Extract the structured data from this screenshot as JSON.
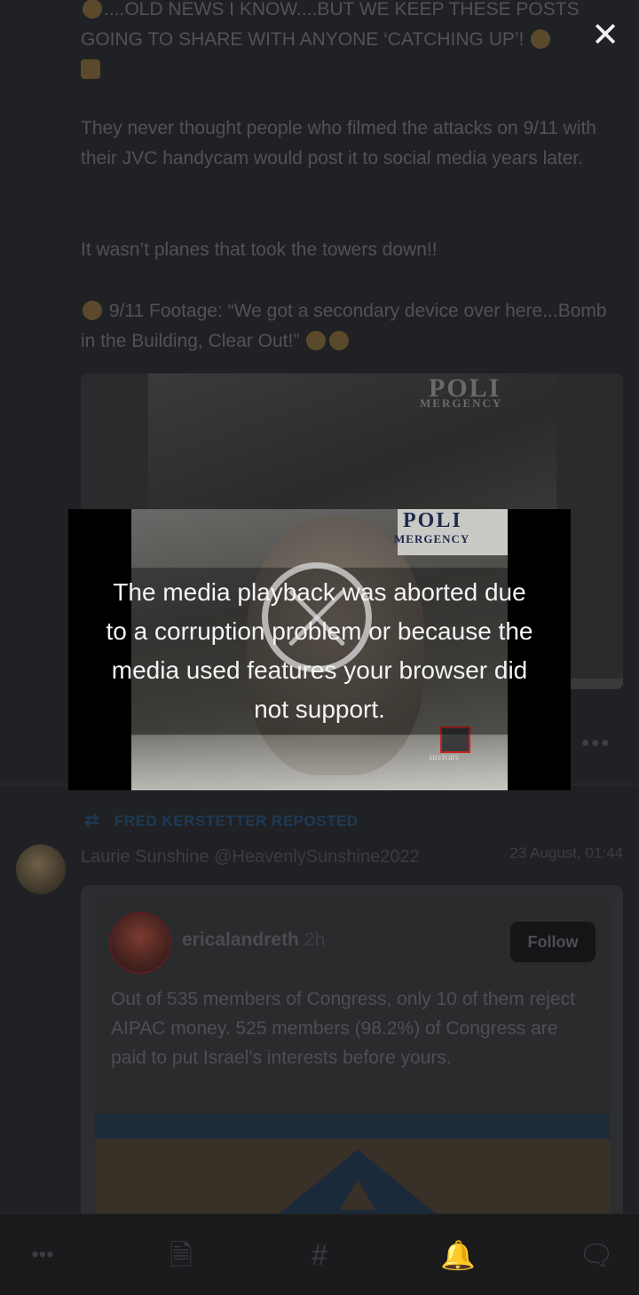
{
  "post": {
    "line1_text": "....OLD NEWS I KNOW....BUT WE KEEP THESE POSTS",
    "line2_text": "GOING TO SHARE WITH ANYONE ‘CATCHING UP’!",
    "paragraph1": "They never thought people who filmed the attacks on 9/11 with their JVC handycam would post it to social media years later.",
    "paragraph2": "It wasn’t planes that took the towers down!!",
    "paragraph3": "9/11 Footage: “We got a secondary device over here...Bomb in the Building, Clear Out!”",
    "video_scene_sign": "POLI",
    "video_scene_sign_sub": "MERGENCY"
  },
  "player": {
    "error_message": "The media playback was aborted due to a corruption problem or because the media used features your browser did not support.",
    "sign_main": "POLI",
    "sign_sub": "MERGENCY",
    "watermark": "HISTORY"
  },
  "repost": {
    "label": "FRED KERSTETTER REPOSTED",
    "author_name": "Laurie Sunshine",
    "author_handle": "@HeavenlySunshine2022",
    "date": "23 August, 01:44",
    "embed": {
      "username": "ericalandreth",
      "time": "2h",
      "follow_label": "Follow",
      "text": "Out of 535 members of Congress, only 10 of them reject AIPAC money.  525 members (98.2%) of Congress are paid to put Israel’s interests before yours."
    }
  },
  "icons": {
    "close": "close-icon",
    "more": "more-dots-icon",
    "repost": "repost-icon",
    "nav": [
      "more-icon",
      "document-icon",
      "hashtag-icon",
      "bell-icon",
      "chat-icon"
    ]
  },
  "colors": {
    "background": "#202124",
    "reposted_label": "#1d3a55",
    "error_text": "#f4f4f4"
  }
}
